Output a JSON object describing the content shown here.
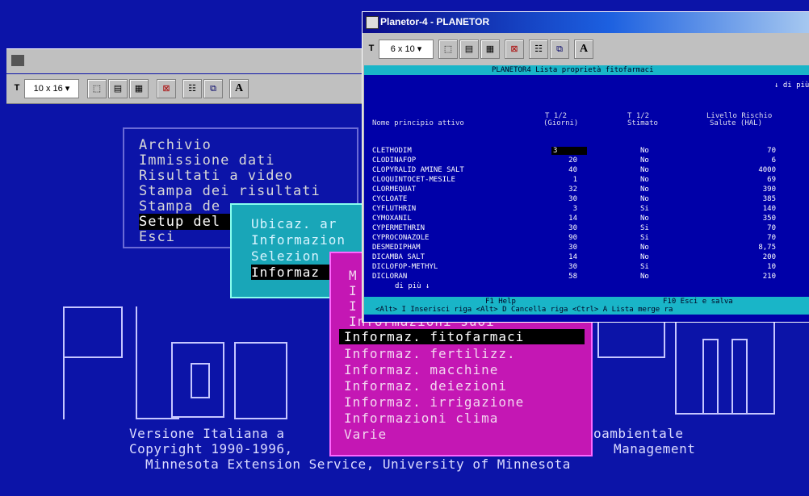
{
  "right_window": {
    "title": "Planetor-4 - PLANETOR",
    "font_select": "6 x 10",
    "screen_title": "PLANETOR4 Lista proprietà fitofarmaci",
    "more_label": "↓ di più",
    "columns": [
      "Nome principio attivo",
      "T 1/2\n(Giorni)",
      "T 1/2\nStimato",
      "Livello Rischio\nSalute (HAL)"
    ],
    "col_t12_a": "T 1/2",
    "col_t12_b": "(Giorni)",
    "col_stim_a": "T 1/2",
    "col_stim_b": "Stimato",
    "col_hal_a": "Livello Rischio",
    "col_hal_b": "Salute (HAL)",
    "rows": [
      {
        "name": "CLETHODIM",
        "t12": "3",
        "stim": "No",
        "hal": "70"
      },
      {
        "name": "CLODINAFOP",
        "t12": "20",
        "stim": "No",
        "hal": "6"
      },
      {
        "name": "CLOPYRALID AMINE SALT",
        "t12": "40",
        "stim": "No",
        "hal": "4000"
      },
      {
        "name": "CLOQUINTOCET-MESILE",
        "t12": "1",
        "stim": "No",
        "hal": "69"
      },
      {
        "name": "CLORMEQUAT",
        "t12": "32",
        "stim": "No",
        "hal": "390"
      },
      {
        "name": "CYCLOATE",
        "t12": "30",
        "stim": "No",
        "hal": "385"
      },
      {
        "name": "CYFLUTHRIN",
        "t12": "3",
        "stim": "Si",
        "hal": "140"
      },
      {
        "name": "CYMOXANIL",
        "t12": "14",
        "stim": "No",
        "hal": "350"
      },
      {
        "name": "CYPERMETHRIN",
        "t12": "30",
        "stim": "Si",
        "hal": "70"
      },
      {
        "name": "CYPROCONAZOLE",
        "t12": "90",
        "stim": "Si",
        "hal": "70"
      },
      {
        "name": "DESMEDIPHAM",
        "t12": "30",
        "stim": "No",
        "hal": "8,75"
      },
      {
        "name": "DICAMBA SALT",
        "t12": "14",
        "stim": "No",
        "hal": "200"
      },
      {
        "name": "DICLOFOP-METHYL",
        "t12": "30",
        "stim": "Si",
        "hal": "10"
      },
      {
        "name": "DICLORAN",
        "t12": "58",
        "stim": "No",
        "hal": "210"
      }
    ],
    "more_bottom": "di più ↓",
    "help_f1": "F1 Help",
    "help_f10": "F10 Esci e salva",
    "help_line": "<Alt> I Inserisci riga   <Alt> D Cancella riga   <Ctrl> A Lista merge ra"
  },
  "left_window": {
    "font_select": "10 x 16"
  },
  "main_menu": {
    "items": [
      "Archivio",
      "Immissione dati",
      "Risultati a video",
      "Stampa dei risultati",
      "Stampa de",
      "Setup del",
      "Esci"
    ]
  },
  "cyan_menu": {
    "items": [
      "Ubicaz. ar",
      "Informazion",
      "Selezion",
      "Informaz"
    ]
  },
  "magenta_menu": {
    "partial": [
      "M",
      "I",
      "I",
      "Informazioni suoi"
    ],
    "items": [
      "Informaz. fitofarmaci",
      "Informaz. fertilizz.",
      "Informaz. macchine",
      "Informaz. deiezioni",
      "Informaz. irrigazione",
      "Informazioni clima",
      "Varie"
    ]
  },
  "credits": {
    "line1_left": "Versione Italiana a",
    "line1_right": "oambientale",
    "line2_left": "Copyright 1990-1996,",
    "line2_right": "Management",
    "line3": "Minnesota Extension Service, University of Minnesota"
  }
}
